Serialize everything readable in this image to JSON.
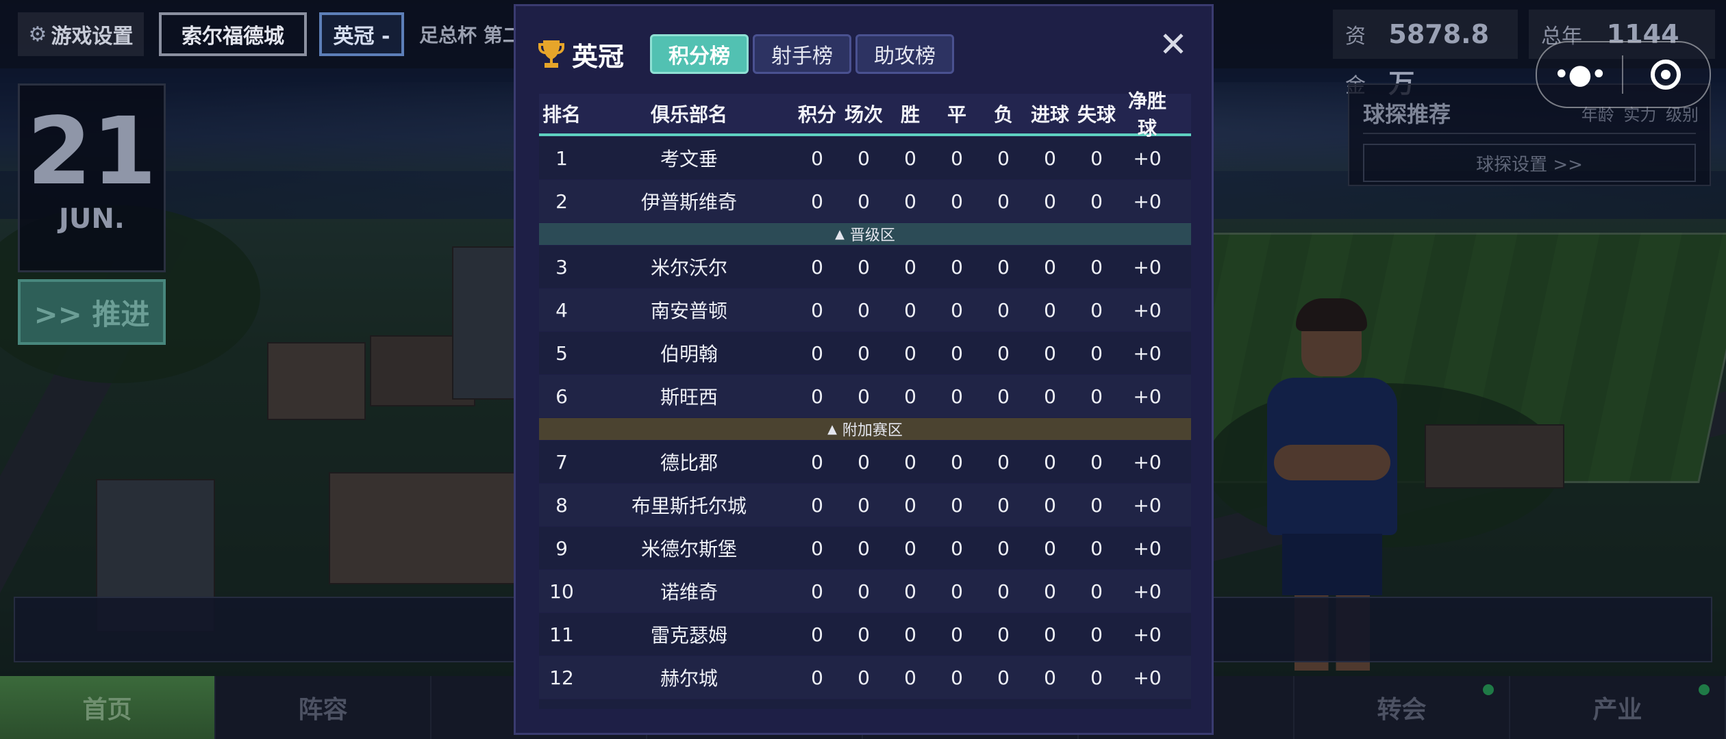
{
  "topbar": {
    "settings_icon": "gear-icon",
    "settings_label": "游戏设置",
    "club_label": "索尔福德城",
    "league_label": "英冠 -",
    "cup_label": "足总杯 第二",
    "funds_label": "资金",
    "funds_value": "5878.8万",
    "wage_label": "总年薪",
    "wage_value": "1144万"
  },
  "date": {
    "day": "21",
    "month": "JUN."
  },
  "advance_label": ">> 推进",
  "scout": {
    "title": "球探推荐",
    "filters": "年龄 实力 级别",
    "settings_label": "球探设置 >>"
  },
  "bottom_nav": [
    "首页",
    "阵容",
    "",
    "",
    "",
    "",
    "转会",
    "产业"
  ],
  "modal": {
    "title": "英冠",
    "tabs": [
      "积分榜",
      "射手榜",
      "助攻榜"
    ],
    "active_tab": 0,
    "close_icon": "close-icon",
    "columns": [
      "排名",
      "俱乐部名",
      "积分",
      "场次",
      "胜",
      "平",
      "负",
      "进球",
      "失球",
      "净胜球"
    ],
    "promotion_label": "晋级区",
    "playoff_label": "附加赛区",
    "rows": [
      {
        "rank": "1",
        "club": "考文垂",
        "pts": "0",
        "played": "0",
        "w": "0",
        "d": "0",
        "l": "0",
        "gf": "0",
        "ga": "0",
        "gd": "+0"
      },
      {
        "rank": "2",
        "club": "伊普斯维奇",
        "pts": "0",
        "played": "0",
        "w": "0",
        "d": "0",
        "l": "0",
        "gf": "0",
        "ga": "0",
        "gd": "+0"
      },
      {
        "rank": "3",
        "club": "米尔沃尔",
        "pts": "0",
        "played": "0",
        "w": "0",
        "d": "0",
        "l": "0",
        "gf": "0",
        "ga": "0",
        "gd": "+0"
      },
      {
        "rank": "4",
        "club": "南安普顿",
        "pts": "0",
        "played": "0",
        "w": "0",
        "d": "0",
        "l": "0",
        "gf": "0",
        "ga": "0",
        "gd": "+0"
      },
      {
        "rank": "5",
        "club": "伯明翰",
        "pts": "0",
        "played": "0",
        "w": "0",
        "d": "0",
        "l": "0",
        "gf": "0",
        "ga": "0",
        "gd": "+0"
      },
      {
        "rank": "6",
        "club": "斯旺西",
        "pts": "0",
        "played": "0",
        "w": "0",
        "d": "0",
        "l": "0",
        "gf": "0",
        "ga": "0",
        "gd": "+0"
      },
      {
        "rank": "7",
        "club": "德比郡",
        "pts": "0",
        "played": "0",
        "w": "0",
        "d": "0",
        "l": "0",
        "gf": "0",
        "ga": "0",
        "gd": "+0"
      },
      {
        "rank": "8",
        "club": "布里斯托尔城",
        "pts": "0",
        "played": "0",
        "w": "0",
        "d": "0",
        "l": "0",
        "gf": "0",
        "ga": "0",
        "gd": "+0"
      },
      {
        "rank": "9",
        "club": "米德尔斯堡",
        "pts": "0",
        "played": "0",
        "w": "0",
        "d": "0",
        "l": "0",
        "gf": "0",
        "ga": "0",
        "gd": "+0"
      },
      {
        "rank": "10",
        "club": "诺维奇",
        "pts": "0",
        "played": "0",
        "w": "0",
        "d": "0",
        "l": "0",
        "gf": "0",
        "ga": "0",
        "gd": "+0"
      },
      {
        "rank": "11",
        "club": "雷克瑟姆",
        "pts": "0",
        "played": "0",
        "w": "0",
        "d": "0",
        "l": "0",
        "gf": "0",
        "ga": "0",
        "gd": "+0"
      },
      {
        "rank": "12",
        "club": "赫尔城",
        "pts": "0",
        "played": "0",
        "w": "0",
        "d": "0",
        "l": "0",
        "gf": "0",
        "ga": "0",
        "gd": "+0"
      }
    ]
  },
  "colors": {
    "modal_bg": "#1e1f46",
    "accent_teal": "#52c1b2",
    "promotion_band": "#2c4b56",
    "playoff_band": "#4b4330",
    "trophy": "#e7a52a"
  }
}
